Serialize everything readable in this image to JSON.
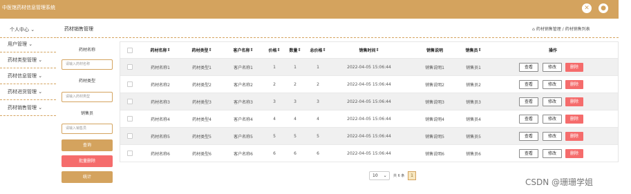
{
  "app": {
    "title": "中医馆药材信息管理系统",
    "accent": "#d4a35e"
  },
  "topbar": {
    "icons": [
      "close-icon",
      "user-icon"
    ]
  },
  "sidebar": {
    "user_center": "个人中心",
    "items": [
      {
        "label": "用户管理"
      },
      {
        "label": "药材类型管理"
      },
      {
        "label": "药材信息管理"
      },
      {
        "label": "药材进货管理"
      },
      {
        "label": "药材销售管理"
      }
    ]
  },
  "page": {
    "title": "药材销售管理",
    "breadcrumb": "药材销售管理 / 药材销售列表"
  },
  "filter": {
    "name_label": "药材名称",
    "name_placeholder": "请输入药材名称",
    "type_label": "药材类型",
    "type_placeholder": "请输入药材类型",
    "seller_label": "销售员",
    "seller_placeholder": "请输入销售员",
    "query_button": "查询",
    "batch_delete_button": "批量删除",
    "stats_button": "统计"
  },
  "table": {
    "columns": [
      "药材名称",
      "药材类型",
      "客户名称",
      "价格",
      "数量",
      "总价格",
      "销售时间",
      "销售说明",
      "销售员",
      "操作"
    ],
    "rows": [
      [
        "药材名称1",
        "药材类型1",
        "客户名称1",
        "1",
        "1",
        "1",
        "2022-04-05 15:06:44",
        "销售说明1",
        "销售员1"
      ],
      [
        "药材名称2",
        "药材类型2",
        "客户名称2",
        "2",
        "2",
        "2",
        "2022-04-05 15:06:44",
        "销售说明2",
        "销售员2"
      ],
      [
        "药材名称3",
        "药材类型3",
        "客户名称3",
        "3",
        "3",
        "3",
        "2022-04-05 15:06:44",
        "销售说明3",
        "销售员3"
      ],
      [
        "药材名称4",
        "药材类型4",
        "客户名称4",
        "4",
        "4",
        "4",
        "2022-04-05 15:06:44",
        "销售说明4",
        "销售员4"
      ],
      [
        "药材名称5",
        "药材类型5",
        "客户名称5",
        "5",
        "5",
        "5",
        "2022-04-05 15:06:44",
        "销售说明5",
        "销售员5"
      ],
      [
        "药材名称6",
        "药材类型6",
        "客户名称6",
        "6",
        "6",
        "6",
        "2022-04-05 15:06:44",
        "销售说明6",
        "销售员6"
      ]
    ],
    "actions": {
      "view": "查看",
      "edit": "修改",
      "delete": "删除"
    }
  },
  "pagination": {
    "page_size": "10",
    "total": "共 6 条",
    "current_page": "1"
  },
  "watermark": "CSDN @珊珊学姐"
}
